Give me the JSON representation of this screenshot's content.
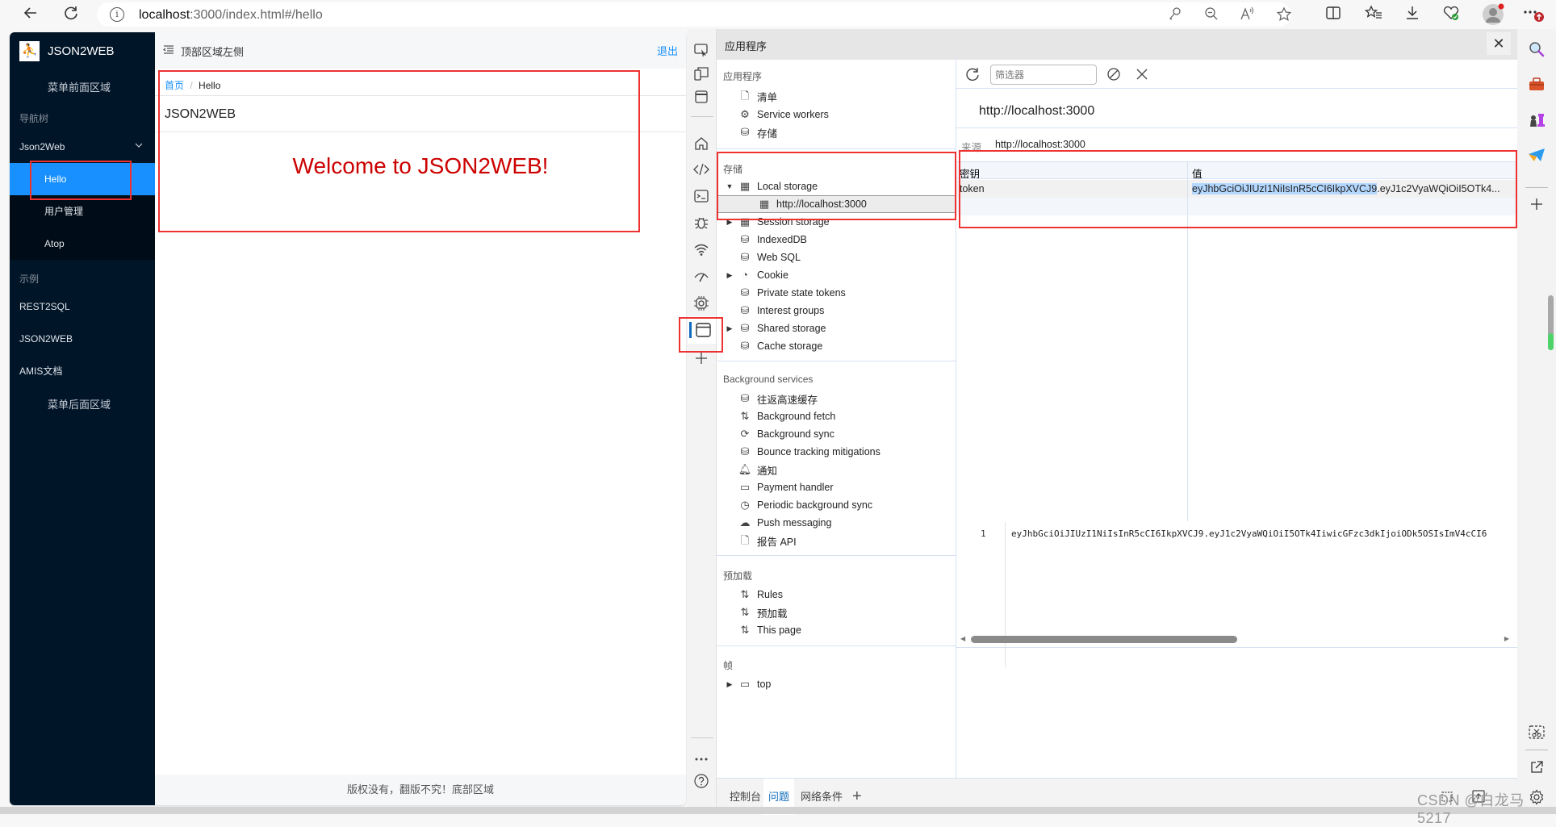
{
  "browser": {
    "url_host": "localhost",
    "url_path": ":3000/index.html#/hello",
    "icons": [
      "back-icon",
      "refresh-icon",
      "info-icon",
      "password-key-icon",
      "zoom-out-icon",
      "read-aloud-icon",
      "favorite-star-icon",
      "split-screen-icon",
      "favorites-icon",
      "downloads-icon",
      "browser-essentials-icon",
      "profile-avatar-icon",
      "more-icon"
    ]
  },
  "app": {
    "brand": "JSON2WEB",
    "logo_glyph": "⛹",
    "sidebar": {
      "before_menu": "菜单前面区域",
      "group_nav": "导航树",
      "parent_item": "Json2Web",
      "sub_items": [
        {
          "label": "Hello",
          "active": true
        },
        {
          "label": "用户管理",
          "active": false
        },
        {
          "label": "Atop",
          "active": false
        }
      ],
      "group_examples": "示例",
      "example_items": [
        "REST2SQL",
        "JSON2WEB",
        "AMIS文档"
      ],
      "after_menu": "菜单后面区域"
    },
    "header": {
      "left_text": "顶部区域左侧",
      "logout": "退出"
    },
    "breadcrumb": {
      "home": "首页",
      "separator": "/",
      "current": "Hello"
    },
    "page_title": "JSON2WEB",
    "welcome": "Welcome to JSON2WEB!",
    "footer": "版权没有，翻版不究！底部区域",
    "colors": {
      "accent": "#1890ff",
      "sidebar_bg": "#011529",
      "welcome": "#cc0000",
      "annotation": "#ee3232"
    }
  },
  "devtools": {
    "panel_title": "应用程序",
    "close_label": "✕",
    "tree": {
      "section_app": "应用程序",
      "app_items": [
        "清单",
        "Service workers",
        "存储"
      ],
      "section_storage": "存储",
      "storage_items": [
        {
          "label": "Local storage",
          "expanded": true,
          "children": [
            "http://localhost:3000"
          ]
        },
        {
          "label": "Session storage",
          "expanded": false
        },
        {
          "label": "IndexedDB"
        },
        {
          "label": "Web SQL"
        },
        {
          "label": "Cookie",
          "expanded": false
        },
        {
          "label": "Private state tokens"
        },
        {
          "label": "Interest groups"
        },
        {
          "label": "Shared storage",
          "expanded": false
        },
        {
          "label": "Cache storage"
        }
      ],
      "section_bg": "Background services",
      "bg_items": [
        "往返高速缓存",
        "Background fetch",
        "Background sync",
        "Bounce tracking mitigations",
        "通知",
        "Payment handler",
        "Periodic background sync",
        "Push messaging",
        "报告 API"
      ],
      "section_preload": "预加载",
      "preload_items": [
        "Rules",
        "预加载",
        "This page"
      ],
      "section_frames": "帧",
      "frame_items": [
        "top"
      ]
    },
    "content": {
      "filter_placeholder": "筛选器",
      "origin_title": "http://localhost:3000",
      "origin_label": "来源",
      "origin_value": "http://localhost:3000",
      "columns": [
        "密钥",
        "值"
      ],
      "rows": [
        {
          "key": "token",
          "value_selected": "eyJhbGciOiJIUzI1NiIsInR5cCI6IkpXVCJ9",
          "value_rest": ".eyJ1c2VyaWQiOiI5OTk4..."
        }
      ],
      "preview_line_number": "1",
      "preview_text": "eyJhbGciOiJIUzI1NiIsInR5cCI6IkpXVCJ9.eyJ1c2VyaWQiOiI5OTk4IiwicGFzc3dkIjoiODk5OSIsImV4cCI6"
    },
    "drawer_tabs": [
      {
        "label": "控制台",
        "active": false
      },
      {
        "label": "问题",
        "active": true
      },
      {
        "label": "网络条件",
        "active": false
      }
    ],
    "drawer_add": "+"
  },
  "watermark": "CSDN @白龙马5217"
}
